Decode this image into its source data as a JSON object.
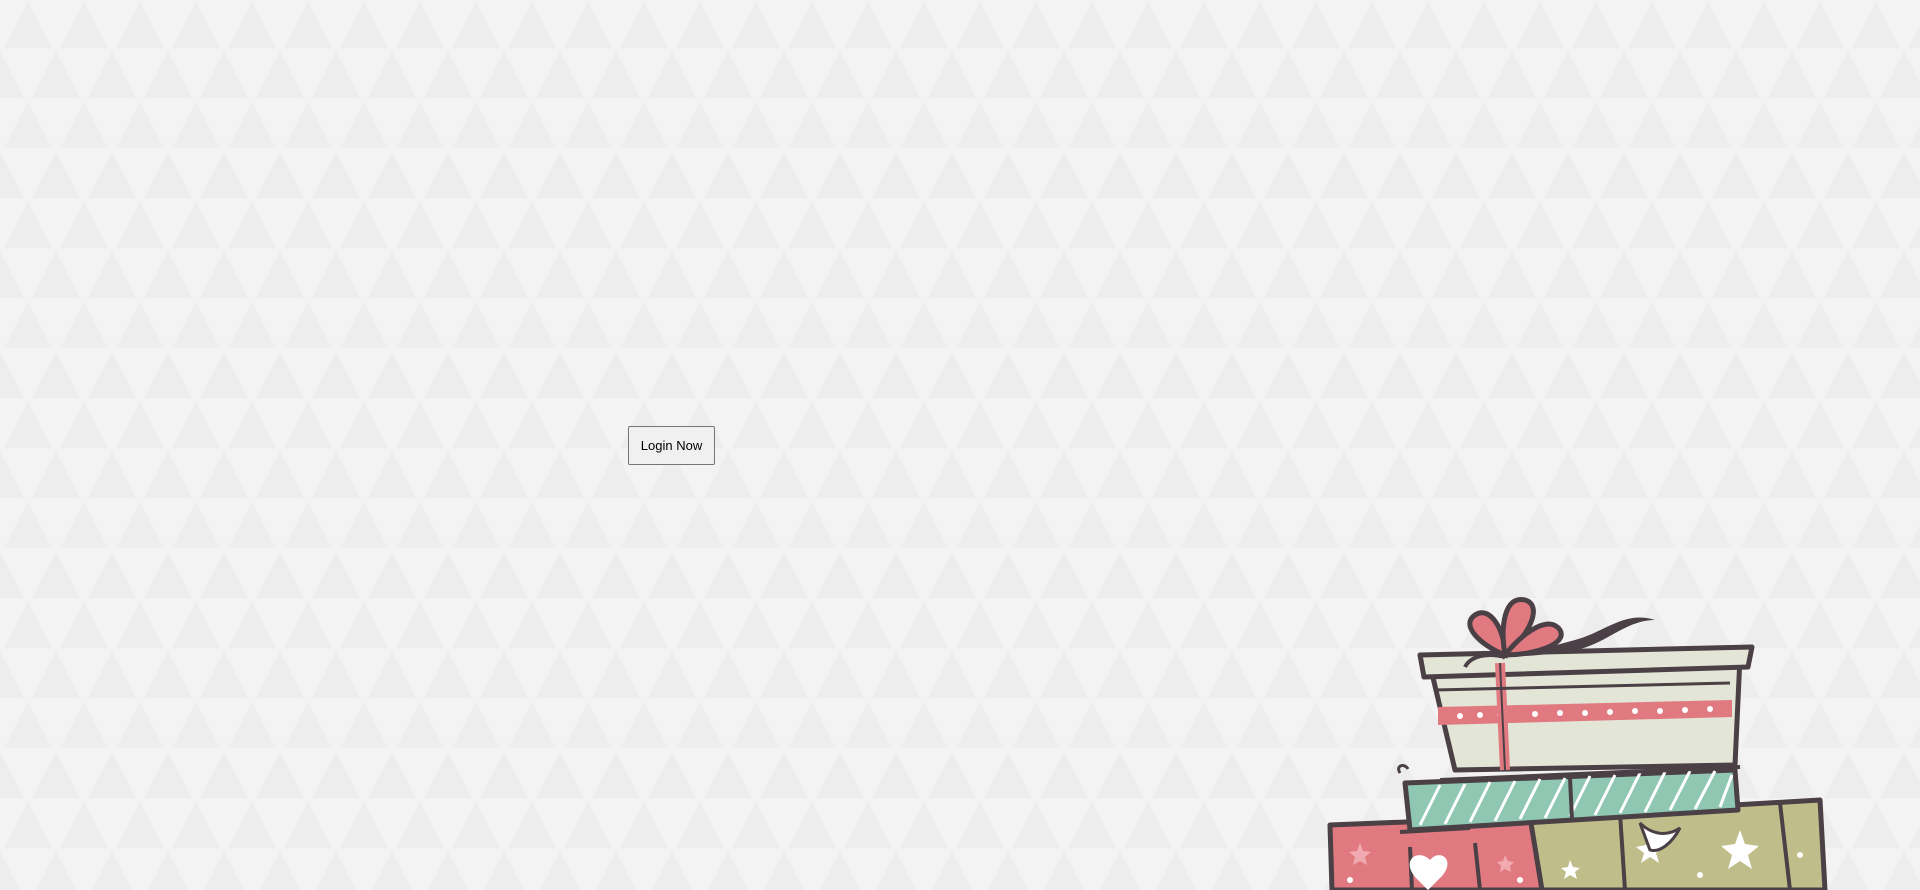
{
  "page": {
    "background_color": "#f3f3f3",
    "pattern_color": "#ebebeb"
  },
  "login": {
    "button_label": "Login Now"
  },
  "illustration": {
    "name": "gift-boxes-illustration",
    "colors": {
      "outline": "#4a4045",
      "ribbon": "#e07a80",
      "box_top": "#e3e5d6",
      "box_mint": "#8fc7b2",
      "box_pink": "#e07a80",
      "box_olive": "#bfbd8a"
    }
  }
}
